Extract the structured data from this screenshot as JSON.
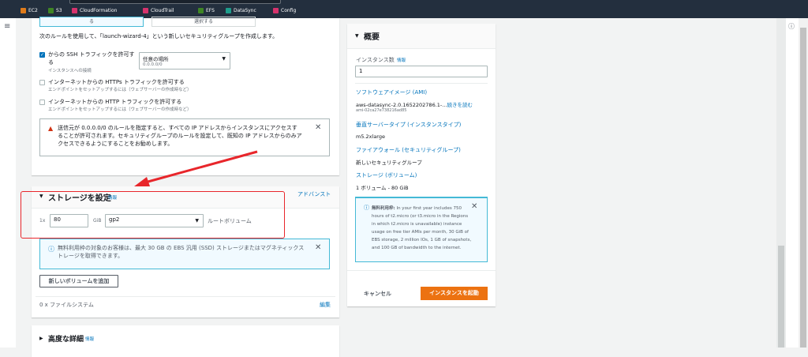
{
  "bookmarks": [
    {
      "label": "EC2",
      "color": "#e07b1a"
    },
    {
      "label": "S3",
      "color": "#3f8624"
    },
    {
      "label": "CloudFormation",
      "color": "#d6336c"
    },
    {
      "label": "CloudTrail",
      "color": "#d6336c"
    },
    {
      "label": "EFS",
      "color": "#3f8624"
    },
    {
      "label": "DataSync",
      "color": "#1e9e8c"
    },
    {
      "label": "Config",
      "color": "#d6336c"
    }
  ],
  "network": {
    "option_partial_1": "る",
    "option_partial_2": "選択する",
    "rule_text": "次のルールを使用して、「launch-wizard-4」という新しいセキュリティグループを作成します。",
    "ssh": {
      "label": "からの SSH トラフィックを許可する",
      "sub": "インスタンスへの接続",
      "checked": true,
      "source": "任意の場所",
      "source_sub": "0.0.0.0/0"
    },
    "https": {
      "label": "インターネットからの HTTPs トラフィックを許可する",
      "sub": "エンドポイントをセットアップするには（ウェブサーバーの作成時など）",
      "checked": false
    },
    "http": {
      "label": "インターネットからの HTTP トラフィックを許可する",
      "sub": "エンドポイントをセットアップするには（ウェブサーバーの作成時など）",
      "checked": false
    },
    "warning": "送信元が 0.0.0.0/0 のルールを指定すると、すべての IP アドレスからインスタンスにアクセスすることが許可されます。セキュリティグループのルールを設定して、既知の IP アドレスからのみアクセスできるようにすることをお勧めします。"
  },
  "storage": {
    "title": "ストレージを設定",
    "info": "情報",
    "advanced": "アドバンスト",
    "count": "1x",
    "size": "80",
    "unit": "GiB",
    "type": "gp2",
    "root": "ルートボリューム",
    "notice": "無料利用枠の対象のお客様は、最大 30 GB の EBS 汎用 (SSD) ストレージまたはマグネティックストレージを取得できます。",
    "add_volume": "新しいボリュームを追加",
    "filesystems": "0 x ファイルシステム",
    "edit": "編集"
  },
  "advanced": {
    "title": "高度な詳細",
    "info": "情報"
  },
  "summary": {
    "title": "概要",
    "instances_label": "インスタンス数",
    "info": "情報",
    "instances": "1",
    "ami_label": "ソフトウェアイメージ (AMI)",
    "ami": "aws-datasync-2.0.1652202786.1-...",
    "ami_more": "続きを読む",
    "ami_id": "ami-02ca27e738216ad85",
    "type_label": "垂直サーバータイプ (インスタンスタイプ)",
    "type": "m5.2xlarge",
    "fw_label": "ファイアウォール (セキュリティグループ)",
    "fw": "新しいセキュリティグループ",
    "storage_label": "ストレージ (ボリューム)",
    "storage": "1 ボリューム - 80 GiB",
    "free_tier_title": "無料利用枠:",
    "free_tier": "In your first year includes 750 hours of t2.micro (or t3.micro in the Regions in which t2.micro is unavailable) instance usage on free tier AMIs per month, 30 GiB of EBS storage, 2 million IOs, 1 GB of snapshots, and 100 GB of bandwidth to the internet.",
    "cancel": "キャンセル",
    "launch": "インスタンスを起動"
  },
  "colors": {
    "accent": "#0073bb",
    "primary": "#ec7211",
    "highlight": "#e8262b"
  }
}
